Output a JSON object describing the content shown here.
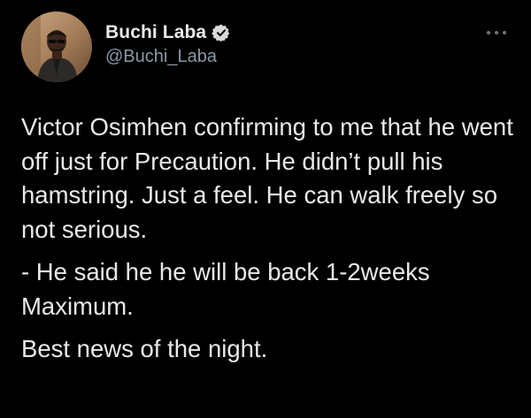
{
  "user": {
    "display_name": "Buchi Laba",
    "handle": "@Buchi_Laba",
    "verified": true,
    "verified_color": "#d9d9d9"
  },
  "tweet": {
    "paragraphs": [
      "Victor Osimhen confirming to me that he went off just for Precaution. He didn’t pull his hamstring. Just a feel. He can walk freely so not serious.",
      "- He said he he will be back 1-2weeks Maximum.",
      "Best news of the night."
    ]
  },
  "icons": {
    "avatar": "profile-photo",
    "verified": "verified-badge-icon",
    "more": "more-options-icon"
  },
  "colors": {
    "background": "#000000",
    "text": "#e7e9ea",
    "secondary_text": "#8b98a5"
  }
}
